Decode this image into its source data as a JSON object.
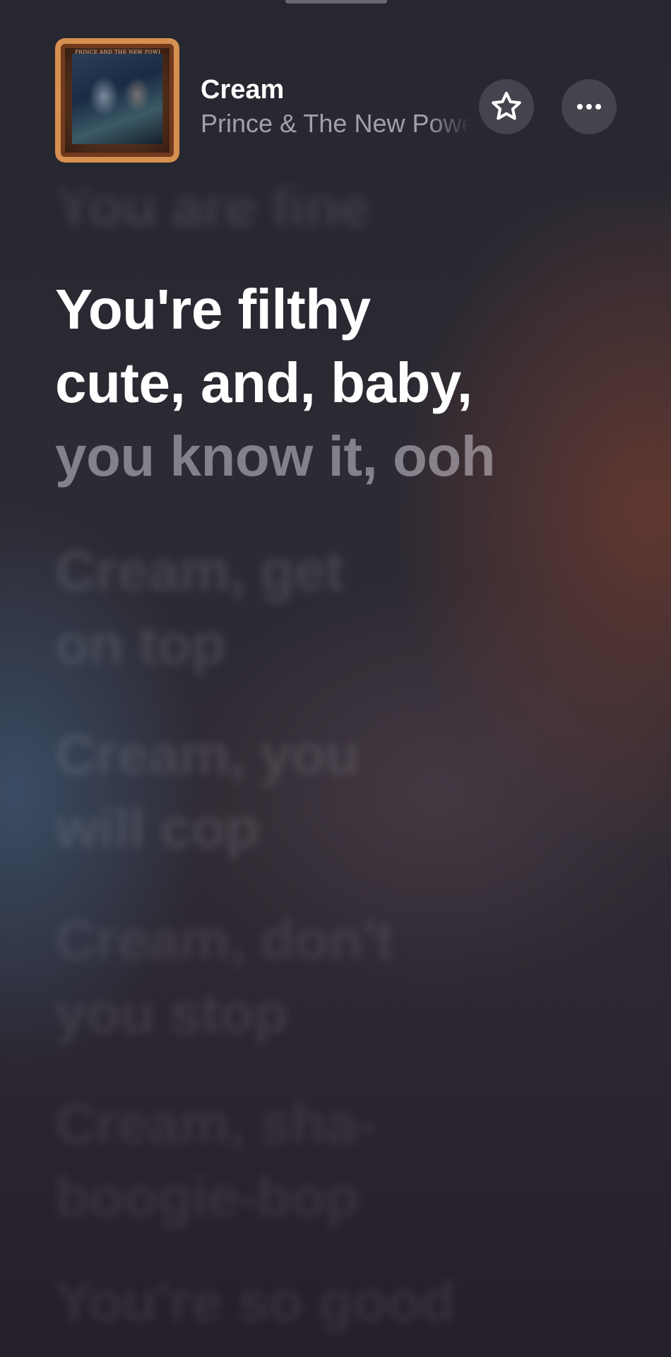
{
  "player": {
    "song_title": "Cream",
    "artist": "Prince & The New Power Generation",
    "artwork_icon": "album-artwork",
    "artwork_text": "PRINCE AND THE NEW POWER GENERATION",
    "star_icon": "star-icon",
    "more_icon": "ellipsis-icon"
  },
  "lyrics": {
    "previous_line": "You are fine",
    "current_line_sung": "You're filthy\ncute, and, baby,",
    "current_line_upcoming": "you know it, ooh",
    "upcoming_lines": [
      "Cream, get\non top",
      "Cream, you\nwill cop",
      "Cream, don't\nyou stop",
      "Cream, sha-\nboogie-bop",
      "You're so good"
    ]
  },
  "colors": {
    "active_lyric": "#ffffff",
    "inactive_lyric": "#9b98a0",
    "accent_warm": "#78402f",
    "accent_cool": "#3c5470"
  }
}
